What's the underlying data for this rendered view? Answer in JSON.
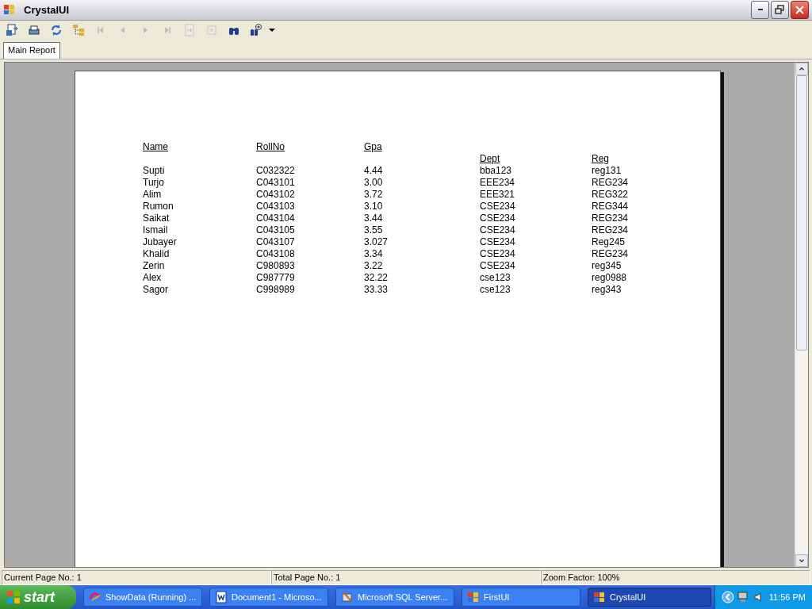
{
  "window": {
    "title": "CrystalUI"
  },
  "toolbar": [
    {
      "kind": "export",
      "disabled": false
    },
    {
      "kind": "print",
      "disabled": false
    },
    {
      "kind": "refresh",
      "disabled": false
    },
    {
      "kind": "tree",
      "disabled": false
    },
    {
      "kind": "first",
      "disabled": true
    },
    {
      "kind": "prev",
      "disabled": true
    },
    {
      "kind": "next",
      "disabled": true
    },
    {
      "kind": "last",
      "disabled": true
    },
    {
      "kind": "goto",
      "disabled": true
    },
    {
      "kind": "stop",
      "disabled": true
    },
    {
      "kind": "find",
      "disabled": false
    },
    {
      "kind": "zoom",
      "disabled": false
    }
  ],
  "tabs": [
    {
      "label": "Main Report",
      "selected": true
    }
  ],
  "report": {
    "header_rows": [
      [
        "Name",
        "RollNo",
        "Gpa",
        null,
        null
      ],
      [
        null,
        null,
        null,
        "Dept",
        "Reg"
      ]
    ],
    "rows": [
      [
        "Supti",
        "C032322",
        "4.44",
        "bba123",
        "reg131"
      ],
      [
        "Turjo",
        "C043101",
        "3.00",
        "EEE234",
        "REG234"
      ],
      [
        "Alim",
        "C043102",
        "3.72",
        "EEE321",
        "REG322"
      ],
      [
        "Rumon",
        "C043103",
        "3.10",
        "CSE234",
        "REG344"
      ],
      [
        "Saikat",
        "C043104",
        "3.44",
        "CSE234",
        "REG234"
      ],
      [
        "Ismail",
        "C043105",
        "3.55",
        "CSE234",
        "REG234"
      ],
      [
        "Jubayer",
        "C043107",
        "3.027",
        "CSE234",
        "Reg245"
      ],
      [
        "Khalid",
        "C043108",
        "3.34",
        "CSE234",
        "REG234"
      ],
      [
        "Zerin",
        "C980893",
        "3.22",
        "CSE234",
        "reg345"
      ],
      [
        "Alex",
        "C987779",
        "32.22",
        "cse123",
        "reg0988"
      ],
      [
        "Sagor",
        "C998989",
        "33.33",
        "cse123",
        "reg343"
      ]
    ]
  },
  "status_bar": [
    "Current Page No.: 1",
    "Total Page No.: 1",
    "Zoom Factor: 100%"
  ],
  "taskbar": {
    "start": "start",
    "items": [
      {
        "label": "ShowData (Running) ...",
        "kind": "vs",
        "selected": false
      },
      {
        "label": "Document1 - Microso...",
        "kind": "word",
        "selected": false
      },
      {
        "label": "Microsoft SQL Server...",
        "kind": "sql",
        "selected": false
      },
      {
        "label": "FirstUI",
        "kind": "app",
        "selected": false
      },
      {
        "label": "CrystalUI",
        "kind": "app",
        "selected": true
      }
    ],
    "clock": "11:56 PM"
  }
}
